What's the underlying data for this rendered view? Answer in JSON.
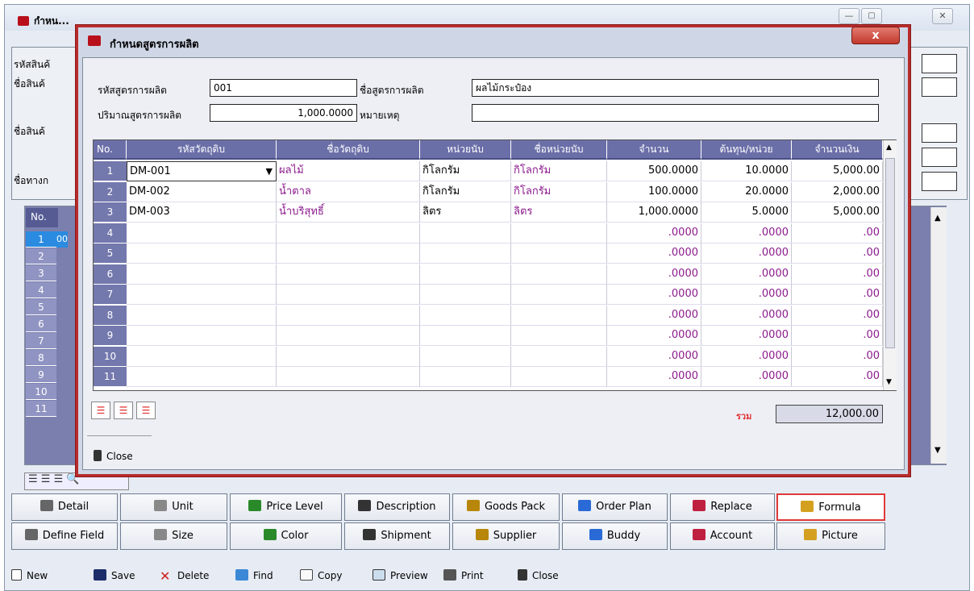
{
  "background_window": {
    "title": "กำหน...",
    "labels": [
      "รหัสสินค้",
      "ชื่อสินค้",
      "ชื่อสินค้",
      "ชื่อทางก"
    ],
    "grid_header_no": "No.",
    "grid_rows": [
      "1",
      "2",
      "3",
      "4",
      "5",
      "6",
      "7",
      "8",
      "9",
      "10",
      "11"
    ],
    "selected_row_code": "00",
    "minimize": "—",
    "maximize": "▢",
    "close": "✕",
    "tabs_row1": [
      "Detail",
      "Unit",
      "Price Level",
      "Description",
      "Goods Pack",
      "Order Plan",
      "Replace",
      "Formula"
    ],
    "tabs_row2": [
      "Define Field",
      "Size",
      "Color",
      "Shipment",
      "Supplier",
      "Buddy",
      "Account",
      "Picture"
    ],
    "active_tab": "Formula",
    "toolbar": {
      "new": "New",
      "save": "Save",
      "delete": "Delete",
      "find": "Find",
      "copy": "Copy",
      "preview": "Preview",
      "print": "Print",
      "close": "Close"
    }
  },
  "dialog": {
    "title": "กำหนดสูตรการผลิต",
    "close_button": "x",
    "form": {
      "code_label": "รหัสสูตรการผลิต",
      "code_value": "001",
      "name_label": "ชื่อสูตรการผลิต",
      "name_value": "ผลไม้กระป๋อง",
      "qty_label": "ปริมาณสูตรการผลิต",
      "qty_value": "1,000.0000",
      "remark_label": "หมายเหตุ",
      "remark_value": ""
    },
    "grid": {
      "columns": [
        "No.",
        "รหัสวัตถุดิบ",
        "ชื่อวัตถุดิบ",
        "หน่วยนับ",
        "ชื่อหน่วยนับ",
        "จำนวน",
        "ต้นทุน/หน่วย",
        "จำนวนเงิน"
      ],
      "rows": [
        {
          "no": "1",
          "code": "DM-001",
          "name": "ผลไม้",
          "unit": "กิโลกรัม",
          "unit_name": "กิโลกรัม",
          "qty": "500.0000",
          "cost": "10.0000",
          "amount": "5,000.00"
        },
        {
          "no": "2",
          "code": "DM-002",
          "name": "น้ำตาล",
          "unit": "กิโลกรัม",
          "unit_name": "กิโลกรัม",
          "qty": "100.0000",
          "cost": "20.0000",
          "amount": "2,000.00"
        },
        {
          "no": "3",
          "code": "DM-003",
          "name": "น้ำบริสุทธิ์",
          "unit": "ลิตร",
          "unit_name": "ลิตร",
          "qty": "1,000.0000",
          "cost": "5.0000",
          "amount": "5,000.00"
        },
        {
          "no": "4",
          "code": "",
          "name": "",
          "unit": "",
          "unit_name": "",
          "qty": ".0000",
          "cost": ".0000",
          "amount": ".00"
        },
        {
          "no": "5",
          "code": "",
          "name": "",
          "unit": "",
          "unit_name": "",
          "qty": ".0000",
          "cost": ".0000",
          "amount": ".00"
        },
        {
          "no": "6",
          "code": "",
          "name": "",
          "unit": "",
          "unit_name": "",
          "qty": ".0000",
          "cost": ".0000",
          "amount": ".00"
        },
        {
          "no": "7",
          "code": "",
          "name": "",
          "unit": "",
          "unit_name": "",
          "qty": ".0000",
          "cost": ".0000",
          "amount": ".00"
        },
        {
          "no": "8",
          "code": "",
          "name": "",
          "unit": "",
          "unit_name": "",
          "qty": ".0000",
          "cost": ".0000",
          "amount": ".00"
        },
        {
          "no": "9",
          "code": "",
          "name": "",
          "unit": "",
          "unit_name": "",
          "qty": ".0000",
          "cost": ".0000",
          "amount": ".00"
        },
        {
          "no": "10",
          "code": "",
          "name": "",
          "unit": "",
          "unit_name": "",
          "qty": ".0000",
          "cost": ".0000",
          "amount": ".00"
        },
        {
          "no": "11",
          "code": "",
          "name": "",
          "unit": "",
          "unit_name": "",
          "qty": ".0000",
          "cost": ".0000",
          "amount": ".00"
        }
      ]
    },
    "total_label": "รวม",
    "total_value": "12,000.00",
    "close_label": "Close",
    "colors": {
      "header": "#6b6fa8",
      "purple_text": "#8b1a8b",
      "total_label": "#e03030",
      "border_red": "#b82b2b"
    }
  }
}
